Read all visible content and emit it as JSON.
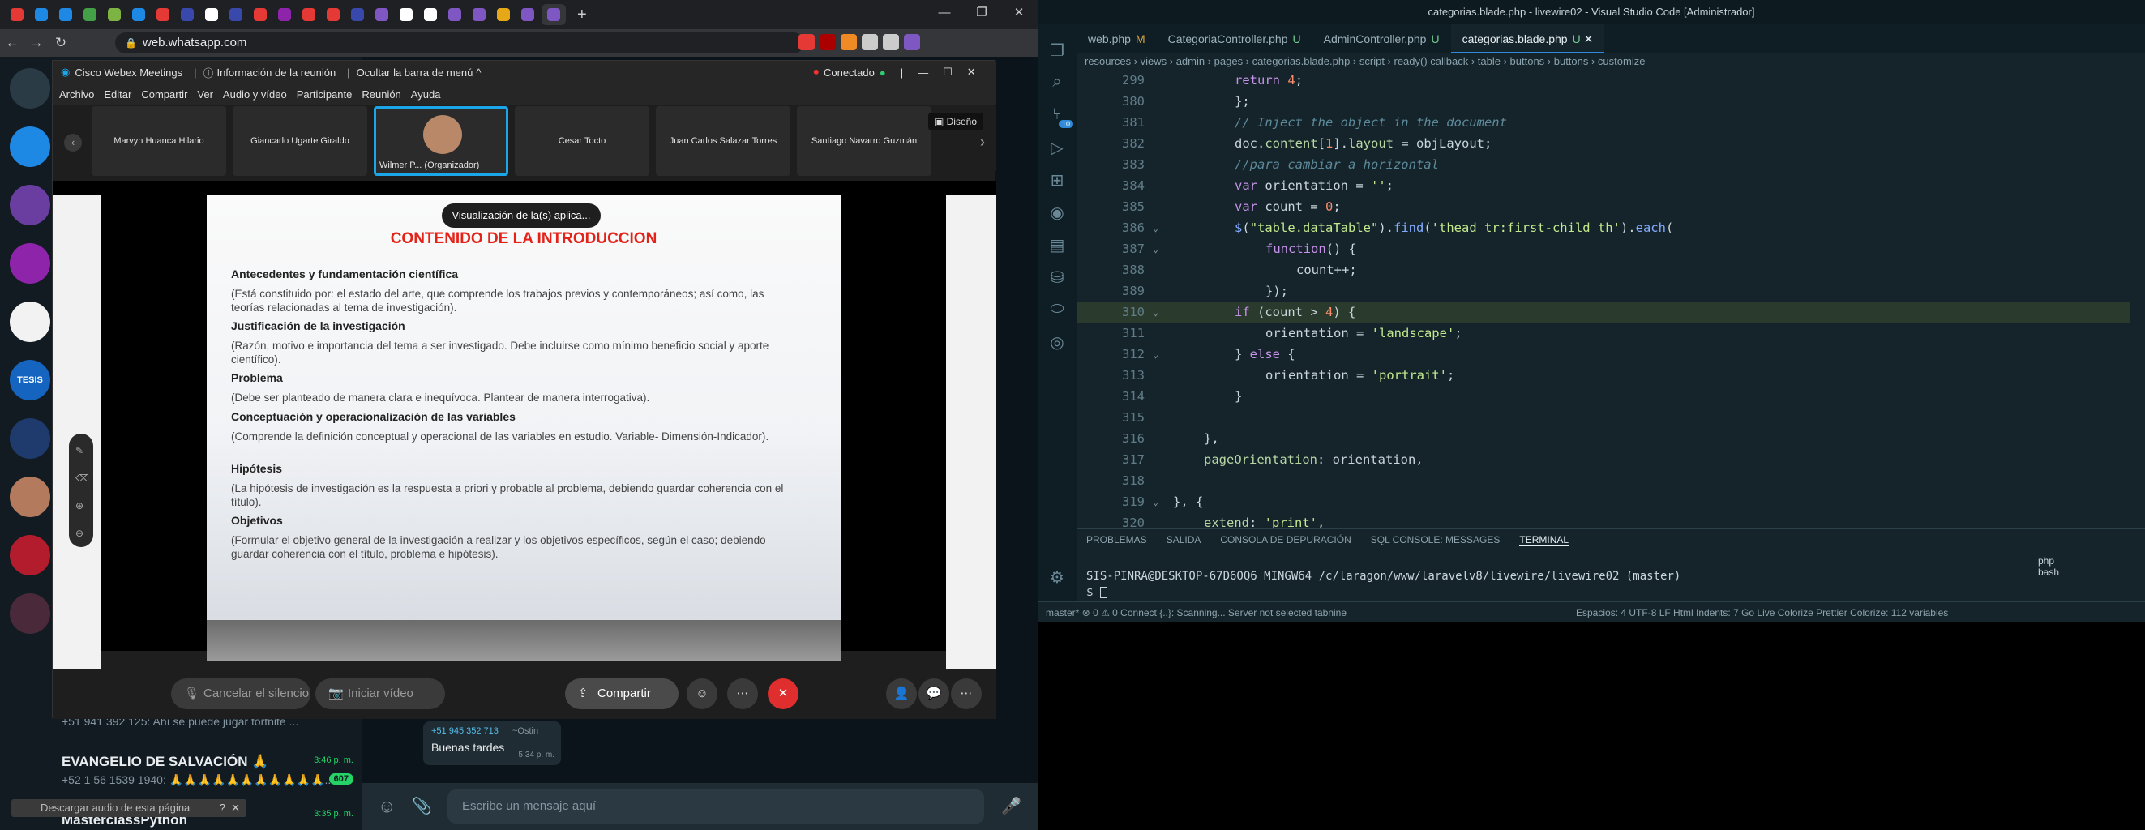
{
  "chrome": {
    "url": "web.whatsapp.com",
    "tab_colors": [
      "#e53935",
      "#1e88e5",
      "#1e88e5",
      "#43a047",
      "#7cb342",
      "#1e88e5",
      "#e53935",
      "#3949ab",
      "#ffffff",
      "#3949ab",
      "#e53935",
      "#8e24aa",
      "#e53935",
      "#e53935",
      "#3949ab",
      "#7e57c2",
      "#ffffff",
      "#ffffff",
      "#7e57c2",
      "#7e57c2",
      "#e6a817",
      "#7e57c2",
      "#7e57c2"
    ],
    "ext_colors": [
      "#e53935",
      "#aa0000",
      "#f08a24",
      "#cccccc",
      "#cccccc",
      "#7e57c2"
    ]
  },
  "whatsapp": {
    "rail_colors": [
      "#2a3b46",
      "#1e88e5",
      "#6a3ea1",
      "#8e24aa",
      "#f2f2f2",
      "#1565c0",
      "#1f3a6d",
      "#b37a5e",
      "#b31c2c",
      "#4a2a3a"
    ],
    "rail_labels": {
      "tesis": "TESIS"
    },
    "chats": [
      {
        "name": "",
        "msg": "+51 941 392 125: Ahí se puede jugar fortnite ...",
        "time": "",
        "badge": ""
      },
      {
        "name": "EVANGELIO DE SALVACIÓN 🙏",
        "msg": "+52 1 56 1539 1940: 🙏🙏🙏🙏🙏🙏🙏🙏🙏🙏🙏...",
        "time": "3:46 p. m.",
        "badge": "607"
      },
      {
        "name": "MasterclassPython",
        "msg": "",
        "time": "3:35 p. m.",
        "badge": ""
      }
    ],
    "bubble": {
      "sender": "+51 945 352 713",
      "alias": "~Ostin",
      "text": "Buenas tardes",
      "time": "5:34 p. m."
    },
    "input_placeholder": "Escribe un mensaje aquí",
    "download_bar": "Descargar audio de esta página"
  },
  "webex": {
    "app_title": "Cisco Webex Meetings",
    "info": "Información de la reunión",
    "hide_menu": "Ocultar la barra de menú",
    "status": "Conectado",
    "menu": [
      "Archivo",
      "Editar",
      "Compartir",
      "Ver",
      "Audio y vídeo",
      "Participante",
      "Reunión",
      "Ayuda"
    ],
    "layout_label": "Diseño",
    "participants": [
      {
        "name": "Marvyn Huanca Hilario",
        "active": false
      },
      {
        "name": "Giancarlo Ugarte Giraldo",
        "active": false
      },
      {
        "name": "Wilmer P... (Organizador)",
        "active": true
      },
      {
        "name": "Cesar Tocto",
        "active": false
      },
      {
        "name": "Juan Carlos Salazar Torres",
        "active": false
      },
      {
        "name": "Santiago Navarro Guzmán",
        "active": false
      }
    ],
    "share_banner": "Visualización de la(s) aplica...",
    "controls": {
      "mute": "Cancelar el silencio",
      "video": "Iniciar vídeo",
      "share": "Compartir"
    }
  },
  "slide": {
    "title": "CONTENIDO DE LA INTRODUCCION",
    "sections": [
      {
        "head": "Antecedentes y fundamentación científica",
        "body": ""
      },
      {
        "head": "",
        "body": "(Está constituido por: el estado del arte, que comprende los trabajos previos y contemporáneos; así como, las teorías relacionadas al tema de investigación)."
      },
      {
        "head": "Justificación de la investigación",
        "body": ""
      },
      {
        "head": "",
        "body": "(Razón, motivo e importancia del tema a ser investigado. Debe incluirse como mínimo beneficio social y aporte científico)."
      },
      {
        "head": "Problema",
        "body": ""
      },
      {
        "head": "",
        "body": "(Debe ser planteado de manera clara e inequívoca. Plantear de manera interrogativa)."
      },
      {
        "head": "Conceptuación y operacionalización de las variables",
        "body": ""
      },
      {
        "head": "",
        "body": "(Comprende la definición conceptual y operacional de las variables en estudio. Variable- Dimensión-Indicador)."
      },
      {
        "head": "Hipótesis",
        "body": ""
      },
      {
        "head": "",
        "body": "(La hipótesis de investigación es la respuesta a priori y probable al problema, debiendo guardar coherencia con el título)."
      },
      {
        "head": "Objetivos",
        "body": ""
      },
      {
        "head": "",
        "body": "(Formular el objetivo general de la investigación a realizar y los objetivos específicos, según el caso; debiendo guardar coherencia con el título, problema e hipótesis)."
      }
    ]
  },
  "vscode": {
    "title": "categorias.blade.php - livewire02 - Visual Studio Code [Administrador]",
    "tabs": [
      {
        "label": "web.php",
        "flag": "M",
        "active": false
      },
      {
        "label": "CategoriaController.php",
        "flag": "U",
        "active": false
      },
      {
        "label": "AdminController.php",
        "flag": "U",
        "active": false
      },
      {
        "label": "categorias.blade.php",
        "flag": "U",
        "active": true
      }
    ],
    "breadcrumb": "resources › views › admin › pages › categorias.blade.php › script › ready() callback › table › buttons › buttons › customize",
    "scm_badge": "10",
    "panel_tabs": [
      "PROBLEMAS",
      "SALIDA",
      "CONSOLA DE DEPURACIÓN",
      "SQL CONSOLE: MESSAGES",
      "TERMINAL"
    ],
    "terminal_prompt": "SIS-PINRA@DESKTOP-67D6OQ6 MINGW64 /c/laragon/www/laravelv8/livewire/livewire02 (master)",
    "terminal_cmd": "$",
    "terminal_shells": [
      "php",
      "bash"
    ],
    "status_left": "master*   ⊗ 0 ⚠ 0   Connect   {..}: Scanning...   Server not selected   tabnine",
    "status_right": "Espacios: 4   UTF-8   LF   Html   Indents: 7   Go Live   Colorize   Prettier   Colorize: 112 variables"
  },
  "code_lines": [
    {
      "n": "299",
      "html": "<span class=\"kw\">return</span> <span class=\"num\">4</span>;",
      "indent": 0,
      "hl": false,
      "fold": false
    },
    {
      "n": "380",
      "html": "};",
      "indent": 0,
      "hl": false,
      "fold": false
    },
    {
      "n": "381",
      "html": "<span class=\"cm\">// Inject the object in the document</span>",
      "indent": 0,
      "hl": false,
      "fold": false
    },
    {
      "n": "382",
      "html": "doc.<span class=\"pr\">content</span>[<span class=\"num\">1</span>].<span class=\"pr\">layout</span> = objLayout;",
      "indent": 0,
      "hl": false,
      "fold": false
    },
    {
      "n": "383",
      "html": "<span class=\"cm\">//para cambiar a horizontal</span>",
      "indent": 0,
      "hl": false,
      "fold": false
    },
    {
      "n": "384",
      "html": "<span class=\"kw\">var</span> orientation = <span class=\"str\">''</span>;",
      "indent": 0,
      "hl": false,
      "fold": false
    },
    {
      "n": "385",
      "html": "<span class=\"kw\">var</span> count = <span class=\"num\">0</span>;",
      "indent": 0,
      "hl": false,
      "fold": false
    },
    {
      "n": "386",
      "html": "<span class=\"fn\">$</span>(<span class=\"str\">\"table.dataTable\"</span>).<span class=\"fn\">find</span>(<span class=\"str\">'thead tr:first-child th'</span>).<span class=\"fn\">each</span>(",
      "indent": 0,
      "hl": false,
      "fold": true
    },
    {
      "n": "387",
      "html": "<span class=\"kw\">function</span>() {",
      "indent": 1,
      "hl": false,
      "fold": true
    },
    {
      "n": "388",
      "html": "count++;",
      "indent": 2,
      "hl": false,
      "fold": false
    },
    {
      "n": "389",
      "html": "});",
      "indent": 1,
      "hl": false,
      "fold": false
    },
    {
      "n": "310",
      "html": "<span class=\"kw\">if</span> (count &gt; <span class=\"num\">4</span>) {",
      "indent": 0,
      "hl": true,
      "fold": true
    },
    {
      "n": "311",
      "html": "orientation = <span class=\"str\">'landscape'</span>;",
      "indent": 1,
      "hl": false,
      "fold": false
    },
    {
      "n": "312",
      "html": "} <span class=\"kw\">else</span> {",
      "indent": 0,
      "hl": false,
      "fold": true
    },
    {
      "n": "313",
      "html": "orientation = <span class=\"str\">'portrait'</span>;",
      "indent": 1,
      "hl": false,
      "fold": false
    },
    {
      "n": "314",
      "html": "}",
      "indent": 0,
      "hl": false,
      "fold": false
    },
    {
      "n": "315",
      "html": "",
      "indent": 0,
      "hl": false,
      "fold": false
    },
    {
      "n": "316",
      "html": "},",
      "indent": -1,
      "hl": false,
      "fold": false
    },
    {
      "n": "317",
      "html": "<span class=\"pr\">pageOrientation</span>: orientation,",
      "indent": -1,
      "hl": false,
      "fold": false
    },
    {
      "n": "318",
      "html": "",
      "indent": 0,
      "hl": false,
      "fold": false
    },
    {
      "n": "319",
      "html": "}, {",
      "indent": -2,
      "hl": false,
      "fold": true
    },
    {
      "n": "320",
      "html": "<span class=\"pr\">extend</span>: <span class=\"str\">'print'</span>,",
      "indent": -1,
      "hl": false,
      "fold": false
    }
  ]
}
